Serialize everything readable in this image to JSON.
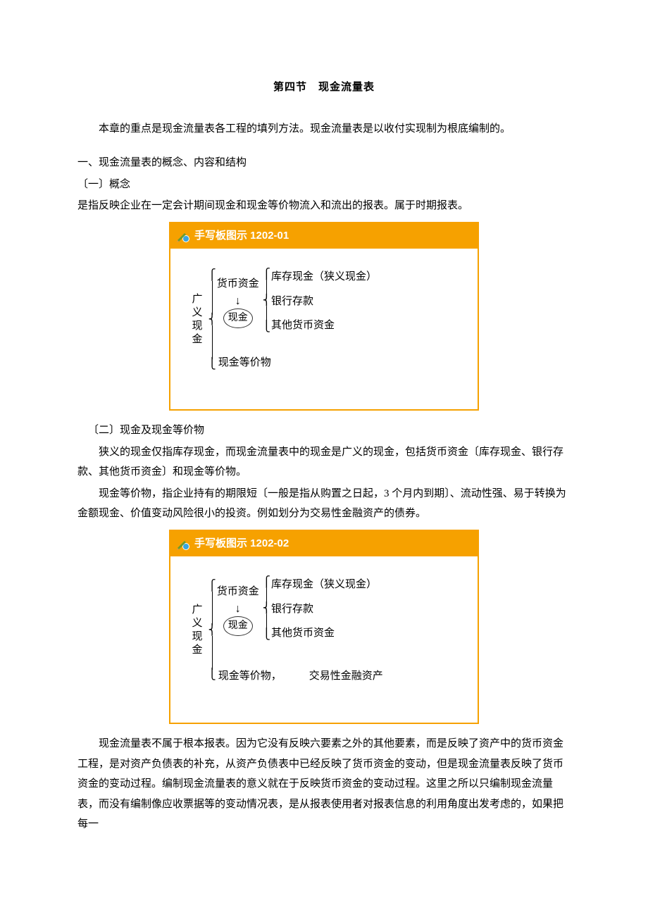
{
  "title": "第四节　现金流量表",
  "intro": "本章的重点是现金流量表各工程的填列方法。现金流量表是以收付实现制为根底编制的。",
  "s1": {
    "h": "一、现金流量表的概念、内容和结构",
    "sub1": "〔一〕概念",
    "p1": "是指反映企业在一定会计期间现金和现金等价物流入和流出的报表。属于时期报表。"
  },
  "panel1": {
    "header": "手写板图示 1202-01",
    "vlabel": "广义现金",
    "moneyFund": "货币资金",
    "cash": "现金",
    "equiv": "现金等价物",
    "items": {
      "a": "库存现金（狭义现金）",
      "b": "银行存款",
      "c": "其他货币资金"
    }
  },
  "s2": {
    "sub2": "〔二〕现金及现金等价物",
    "p1": "狭义的现金仅指库存现金，而现金流量表中的现金是广义的现金，包括货币资金〔库存现金、银行存款、其他货币资金〕和现金等价物。",
    "p2": "现金等价物，指企业持有的期限短〔一般是指从购置之日起，3 个月内到期〕、流动性强、易于转换为金额现金、价值变动风险很小的投资。例如划分为交易性金融资产的债券。"
  },
  "panel2": {
    "header": "手写板图示 1202-02",
    "vlabel": "广义现金",
    "moneyFund": "货币资金",
    "cash": "现金",
    "equiv": "现金等价物，",
    "extra": "交易性金融资产",
    "items": {
      "a": "库存现金（狭义现金）",
      "b": "银行存款",
      "c": "其他货币资金"
    }
  },
  "tail": {
    "p1": "现金流量表不属于根本报表。因为它没有反映六要素之外的其他要素，而是反映了资产中的货币资金工程，是对资产负债表的补充，从资产负债表中已经反映了货币资金的变动，但是现金流量表反映了货币资金的变动过程。编制现金流量表的意义就在于反映货币资金的变动过程。这里之所以只编制现金流量表，而没有编制像应收票据等的变动情况表，是从报表使用者对报表信息的利用角度出发考虑的，如果把每一"
  }
}
